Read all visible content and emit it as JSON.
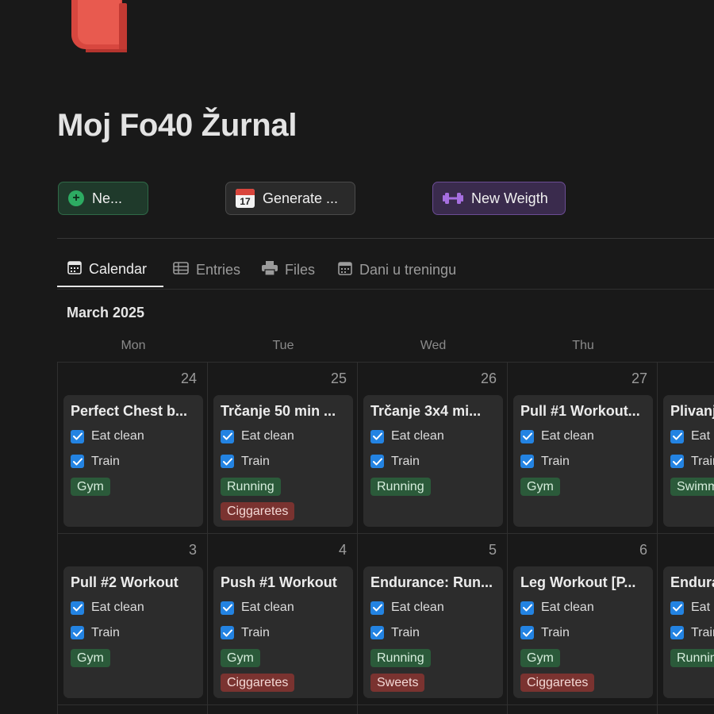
{
  "page": {
    "title": "Moj Fo40 Žurnal",
    "icon": "red-book-icon"
  },
  "buttons": {
    "new_label": "Ne...",
    "generate_label": "Generate ...",
    "generate_icon_day": "17",
    "weight_label": "New Weigth"
  },
  "tabs": [
    {
      "label": "Calendar",
      "icon": "calendar-icon",
      "active": true
    },
    {
      "label": "Entries",
      "icon": "table-icon",
      "active": false
    },
    {
      "label": "Files",
      "icon": "printer-icon",
      "active": false
    },
    {
      "label": "Dani u treningu",
      "icon": "calendar-icon",
      "active": false
    }
  ],
  "calendar": {
    "month_label": "March 2025",
    "weekdays": [
      "Mon",
      "Tue",
      "Wed",
      "Thu"
    ],
    "weeks": [
      {
        "days": [
          {
            "number": "24",
            "entry": {
              "title": "Perfect Chest b...",
              "eat_clean": "Eat clean",
              "train": "Train",
              "tags": [
                "Gym"
              ]
            }
          },
          {
            "number": "25",
            "entry": {
              "title": "Trčanje 50 min ...",
              "eat_clean": "Eat clean",
              "train": "Train",
              "tags": [
                "Running",
                "Ciggaretes"
              ]
            }
          },
          {
            "number": "26",
            "entry": {
              "title": "Trčanje 3x4 mi...",
              "eat_clean": "Eat clean",
              "train": "Train",
              "tags": [
                "Running"
              ]
            }
          },
          {
            "number": "27",
            "entry": {
              "title": "Pull #1 Workout...",
              "eat_clean": "Eat clean",
              "train": "Train",
              "tags": [
                "Gym"
              ]
            }
          },
          {
            "number": "",
            "entry": {
              "title": "Plivanje",
              "eat_clean": "Eat clean",
              "train": "Train",
              "tags": [
                "Swimming"
              ]
            }
          }
        ]
      },
      {
        "days": [
          {
            "number": "3",
            "entry": {
              "title": "Pull #2 Workout",
              "eat_clean": "Eat clean",
              "train": "Train",
              "tags": [
                "Gym"
              ]
            }
          },
          {
            "number": "4",
            "entry": {
              "title": "Push #1 Workout",
              "eat_clean": "Eat clean",
              "train": "Train",
              "tags": [
                "Gym",
                "Ciggaretes"
              ]
            }
          },
          {
            "number": "5",
            "entry": {
              "title": "Endurance: Run...",
              "eat_clean": "Eat clean",
              "train": "Train",
              "tags": [
                "Running",
                "Sweets"
              ]
            }
          },
          {
            "number": "6",
            "entry": {
              "title": "Leg Workout [P...",
              "eat_clean": "Eat clean",
              "train": "Train",
              "tags": [
                "Gym",
                "Ciggaretes"
              ]
            }
          },
          {
            "number": "",
            "entry": {
              "title": "Endurance",
              "eat_clean": "Eat clean",
              "train": "Train",
              "tags": [
                "Running"
              ]
            }
          }
        ]
      }
    ]
  },
  "tag_colors": {
    "Gym": "green",
    "Running": "green",
    "Swimming": "green",
    "Ciggaretes": "red",
    "Sweets": "red"
  }
}
